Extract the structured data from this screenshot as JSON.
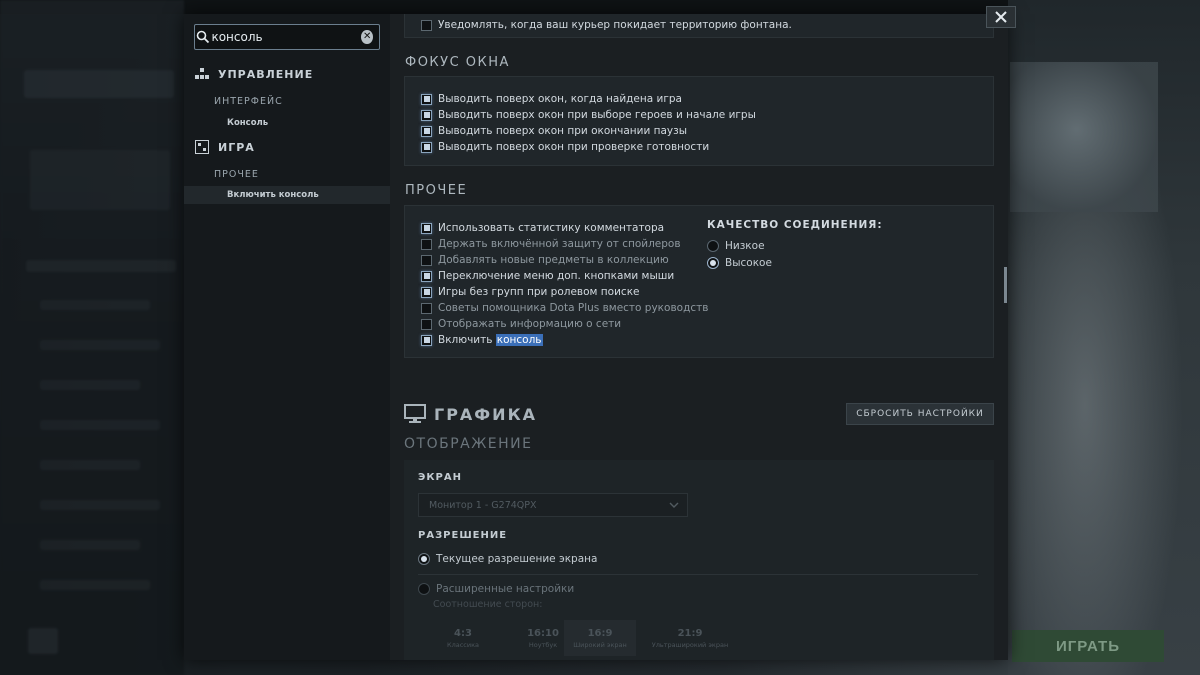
{
  "background": {
    "play_button": "ИГРАТЬ"
  },
  "search": {
    "value": "консоль",
    "placeholder": ""
  },
  "sidebar": {
    "categories": [
      {
        "label": "УПРАВЛЕНИЕ",
        "icon": "controls-icon",
        "sub": "ИНТЕРФЕЙС",
        "item": "Консоль"
      },
      {
        "label": "ИГРА",
        "icon": "game-icon",
        "sub": "ПРОЧЕЕ",
        "item": "Включить консоль"
      }
    ]
  },
  "content": {
    "top_notice": "Уведомлять, когда ваш курьер покидает территорию фонтана.",
    "focus": {
      "title": "ФОКУС ОКНА",
      "options": [
        {
          "label": "Выводить поверх окон, когда найдена игра",
          "checked": true
        },
        {
          "label": "Выводить поверх окон при выборе героев и начале игры",
          "checked": true
        },
        {
          "label": "Выводить поверх окон при окончании паузы",
          "checked": true
        },
        {
          "label": "Выводить поверх окон при проверке готовности",
          "checked": true
        }
      ]
    },
    "other": {
      "title": "ПРОЧЕЕ",
      "options": [
        {
          "label": "Использовать статистику комментатора",
          "checked": true
        },
        {
          "label": "Держать включённой защиту от спойлеров",
          "checked": false
        },
        {
          "label": "Добавлять новые предметы в коллекцию",
          "checked": false
        },
        {
          "label": "Переключение меню доп. кнопками мыши",
          "checked": true
        },
        {
          "label": "Игры без групп при ролевом поиске",
          "checked": true
        },
        {
          "label": "Советы помощника Dota Plus вместо руководств",
          "checked": false
        },
        {
          "label": "Отображать информацию о сети",
          "checked": false
        },
        {
          "label_prefix": "Включить ",
          "label_highlight": "консоль",
          "checked": true
        }
      ],
      "connection": {
        "title": "КАЧЕСТВО СОЕДИНЕНИЯ:",
        "options": [
          {
            "label": "Низкое",
            "selected": false
          },
          {
            "label": "Высокое",
            "selected": true
          }
        ]
      }
    },
    "graphics": {
      "title": "ГРАФИКА",
      "reset_label": "СБРОСИТЬ НАСТРОЙКИ",
      "display_title": "ОТОБРАЖЕНИЕ",
      "screen_label": "ЭКРАН",
      "monitor_value": "Монитор 1 - G274QPX",
      "resolution_label": "РАЗРЕШЕНИЕ",
      "current_resolution": "Текущее разрешение экрана",
      "advanced": "Расширенные настройки",
      "aspect_label": "Соотношение сторон:",
      "aspects": [
        {
          "ratio": "4:3",
          "name": "Классика"
        },
        {
          "ratio": "16:10",
          "name": "Ноутбук"
        },
        {
          "ratio": "16:9",
          "name": "Широкий экран"
        },
        {
          "ratio": "21:9",
          "name": "Ультраширокий экран"
        }
      ]
    }
  },
  "colors": {
    "accent": "#3b6fb8",
    "panel": "#20262a",
    "window": "#1b1f22"
  }
}
